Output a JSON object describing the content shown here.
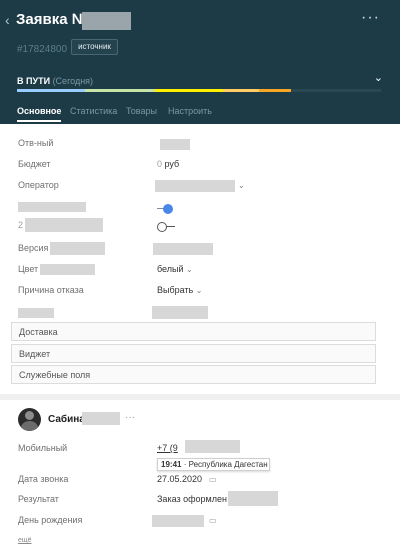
{
  "header": {
    "title": "Заявка №",
    "lead_id": "#17824800",
    "source_label": "источник",
    "status": "В ПУТИ",
    "status_sub": "(Сегодня)",
    "more_icon": "more-horizontal-icon",
    "pipeline_colors": [
      "#99ccff",
      "#c6e4a8",
      "#fff000",
      "#ffcc66",
      "#f5a623"
    ]
  },
  "tabs": [
    {
      "label": "Основное"
    },
    {
      "label": "Статистика"
    },
    {
      "label": "Товары"
    },
    {
      "label": "Настроить"
    }
  ],
  "fields": {
    "owner": {
      "label": "Отв-ный"
    },
    "budget": {
      "label": "Бюджет",
      "value": "0",
      "unit": "руб"
    },
    "operator": {
      "label": "Оператор"
    },
    "row4": {
      "toggle": "on"
    },
    "row5": {
      "prefix": "2",
      "toggle": "off"
    },
    "version": {
      "label": "Версия"
    },
    "color": {
      "label": "Цвет",
      "value": "белый"
    },
    "refusal": {
      "label": "Причина отказа",
      "value": "Выбрать"
    }
  },
  "sections": [
    "Доставка",
    "Виджет",
    "Служебные поля"
  ],
  "contact": {
    "name": "Сабина",
    "dots": "···",
    "mobile_label": "Мобильный",
    "mobile_value": "+7 (9",
    "tooltip_time": "19:41",
    "tooltip_region": "· Республика Дагестан",
    "call_date_label": "Дата звонка",
    "call_date_value": "27.05.2020",
    "result_label": "Результат",
    "result_value": "Заказ оформлен",
    "birthday_label": "День рождения",
    "more_link": "ещё"
  }
}
